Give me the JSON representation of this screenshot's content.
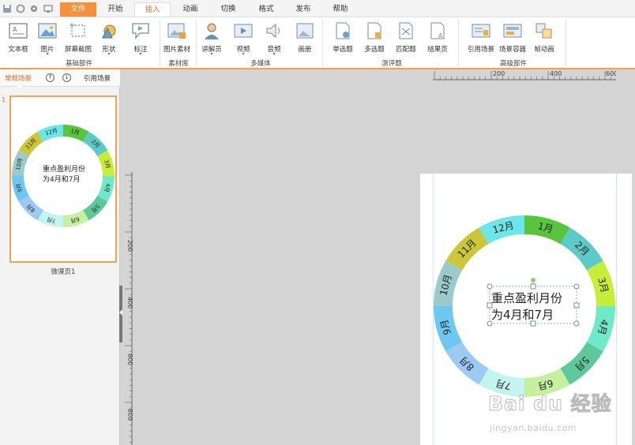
{
  "menubar": {
    "tabs": [
      {
        "label": "文件",
        "state": "file"
      },
      {
        "label": "开始",
        "state": ""
      },
      {
        "label": "插入",
        "state": "active"
      },
      {
        "label": "动画",
        "state": ""
      },
      {
        "label": "切换",
        "state": ""
      },
      {
        "label": "格式",
        "state": ""
      },
      {
        "label": "发布",
        "state": ""
      },
      {
        "label": "帮助",
        "state": ""
      }
    ]
  },
  "ribbon": {
    "tools": [
      {
        "label": "文本框",
        "icon": "textbox-icon",
        "dropdown": false
      },
      {
        "label": "图片",
        "icon": "picture-icon",
        "dropdown": true
      },
      {
        "label": "屏幕截图",
        "icon": "screenshot-icon",
        "dropdown": false
      },
      {
        "label": "形状",
        "icon": "shape-icon",
        "dropdown": true
      },
      {
        "label": "标注",
        "icon": "callout-icon",
        "dropdown": true
      },
      {
        "label": "图片素材",
        "icon": "image-library-icon",
        "dropdown": false
      },
      {
        "label": "讲解员",
        "icon": "presenter-icon",
        "dropdown": true
      },
      {
        "label": "视频",
        "icon": "video-icon",
        "dropdown": true
      },
      {
        "label": "音频",
        "icon": "audio-icon",
        "dropdown": true
      },
      {
        "label": "画册",
        "icon": "album-icon",
        "dropdown": false
      },
      {
        "label": "单选题",
        "icon": "single-choice-icon",
        "dropdown": false
      },
      {
        "label": "多选题",
        "icon": "multi-choice-icon",
        "dropdown": false
      },
      {
        "label": "匹配题",
        "icon": "matching-icon",
        "dropdown": false
      },
      {
        "label": "结果页",
        "icon": "result-page-icon",
        "dropdown": false
      },
      {
        "label": "引用场景",
        "icon": "reference-scene-icon",
        "dropdown": false
      },
      {
        "label": "场景容器",
        "icon": "scene-container-icon",
        "dropdown": false
      },
      {
        "label": "帧动画",
        "icon": "frame-animation-icon",
        "dropdown": false
      }
    ],
    "groups": [
      "基础部件",
      "素材库",
      "多媒体",
      "测评题",
      "高级部件"
    ]
  },
  "left_panel": {
    "tab_active": "常规场景",
    "tab_other": "引用场景",
    "slide_number": "1",
    "slide_caption": "微课页1"
  },
  "ruler": {
    "h_labels": [
      "200",
      "400",
      "600"
    ],
    "v_labels": [
      "200",
      "400",
      "600",
      "800"
    ]
  },
  "slide": {
    "center_text_line1": "重点盈利月份",
    "center_text_line2": "为4月和7月",
    "ring_segments": [
      {
        "label": "1月",
        "color": "#5ac43c"
      },
      {
        "label": "2月",
        "color": "#5ecac8"
      },
      {
        "label": "3月",
        "color": "#c8ec3a"
      },
      {
        "label": "4月",
        "color": "#6eeac8"
      },
      {
        "label": "5月",
        "color": "#5ec89a"
      },
      {
        "label": "6月",
        "color": "#c4f0a0"
      },
      {
        "label": "7月",
        "color": "#c4f4f0"
      },
      {
        "label": "8月",
        "color": "#9ccaf4"
      },
      {
        "label": "9月",
        "color": "#6cc8f0"
      },
      {
        "label": "10月",
        "color": "#9acaca"
      },
      {
        "label": "11月",
        "color": "#cac83a"
      },
      {
        "label": "12月",
        "color": "#6ce6ea"
      }
    ]
  },
  "watermark": {
    "logo": "Bai du 经验",
    "url": "jingyan.baidu.com"
  },
  "colors": {
    "accent": "#f7903a",
    "selection": "#6a8fb0"
  }
}
